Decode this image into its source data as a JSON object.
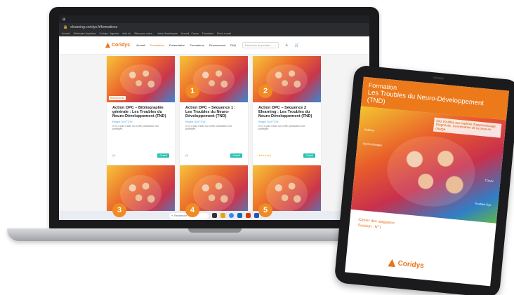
{
  "browser": {
    "url": "elearning.coridys.fr/formations",
    "bookmarks": [
      "Accueil",
      "Webinaire Aquitaine",
      "Coridys - Agenda",
      "Actu ch",
      "Sites pour notre...",
      "Infos Numériques",
      "Accueil - Canva",
      "Formation",
      "Envoi e-mail"
    ]
  },
  "site": {
    "logo": "Coridys",
    "nav": [
      "Accueil",
      "Formations",
      "Présentation",
      "Formateurs",
      "Financement",
      "FAQ"
    ],
    "active_nav": "Formations",
    "search_placeholder": "Recherche de produits…"
  },
  "cards": [
    {
      "badge": "",
      "tag": "Bibliographie",
      "title": "Action DPC – Bibliographie générale : Les Troubles du Neuro-Développement (TND)",
      "author": "Régine GUITTON",
      "desc": "Il n'y a pas d'avis sur cette publication est protégée.",
      "rating": "(0)",
      "price": "Gratuit"
    },
    {
      "badge": "1",
      "tag": "",
      "title": "Action DPC – Séquence 1 : Les Troubles du Neuro-Développement (TND)",
      "author": "Régine GUITTON",
      "desc": "Il n'y a pas d'avis sur cette publication est protégée.",
      "rating": "(0)",
      "price": "Gratuit"
    },
    {
      "badge": "2",
      "tag": "",
      "title": "Action DPC – Séquence 2 Elearning : Les Troubles du Neuro-Développement (TND)",
      "author": "Régine GUITTON",
      "desc": "Il n'y a pas d'avis sur cette publication est protégée.",
      "rating": "★★★★★ (1)",
      "price": "Gratuit"
    }
  ],
  "cards_row2_badges": [
    "3",
    "4",
    "5"
  ],
  "taskbar": {
    "search": "Recherche"
  },
  "tablet": {
    "heading_1": "Formation",
    "heading_2": "Les Troubles du Neuro-Développement (TND)",
    "note": "Des troubles aux repères d'apprentissage. Diagnostic. Coordination de la prise en charge.",
    "labels": [
      "Autisme",
      "Apprentissages",
      "TDA/H",
      "Troubles Dys"
    ],
    "body_1": "Cahier des stagiaires",
    "body_2": "Session : N°1",
    "logo": "Coridys"
  },
  "colors": {
    "brand_orange": "#e8731a",
    "accent_teal": "#27c2b6",
    "link_blue": "#4aa3df"
  }
}
